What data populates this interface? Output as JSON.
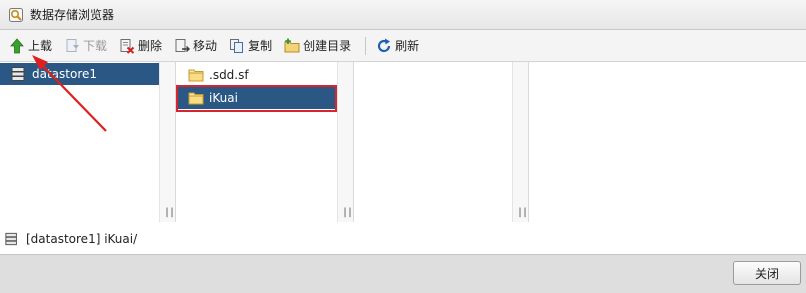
{
  "window": {
    "title": "数据存储浏览器",
    "icon": "datastore-browser-icon"
  },
  "toolbar": {
    "upload": {
      "label": "上载",
      "icon": "upload-arrow-icon",
      "enabled": true
    },
    "download": {
      "label": "下载",
      "icon": "download-icon",
      "enabled": false
    },
    "delete": {
      "label": "删除",
      "icon": "delete-icon",
      "enabled": true
    },
    "move": {
      "label": "移动",
      "icon": "move-icon",
      "enabled": true
    },
    "copy": {
      "label": "复制",
      "icon": "copy-icon",
      "enabled": true
    },
    "mkdir": {
      "label": "创建目录",
      "icon": "new-folder-icon",
      "enabled": true
    },
    "refresh": {
      "label": "刷新",
      "icon": "refresh-icon",
      "enabled": true
    }
  },
  "panes": {
    "datastores": [
      {
        "label": "datastore1",
        "icon": "datastore-icon",
        "selected": true
      }
    ],
    "folders": [
      {
        "label": ".sdd.sf",
        "icon": "folder-icon",
        "selected": false
      },
      {
        "label": "iKuai",
        "icon": "folder-icon",
        "selected": true
      }
    ],
    "grip": "|||"
  },
  "path": {
    "text": "[datastore1] iKuai/",
    "icon": "datastore-icon"
  },
  "footer": {
    "close_label": "关闭"
  },
  "colors": {
    "selection": "#2b5784",
    "annotation": "#d8242f",
    "upload_arrow": "#3aa12c"
  }
}
